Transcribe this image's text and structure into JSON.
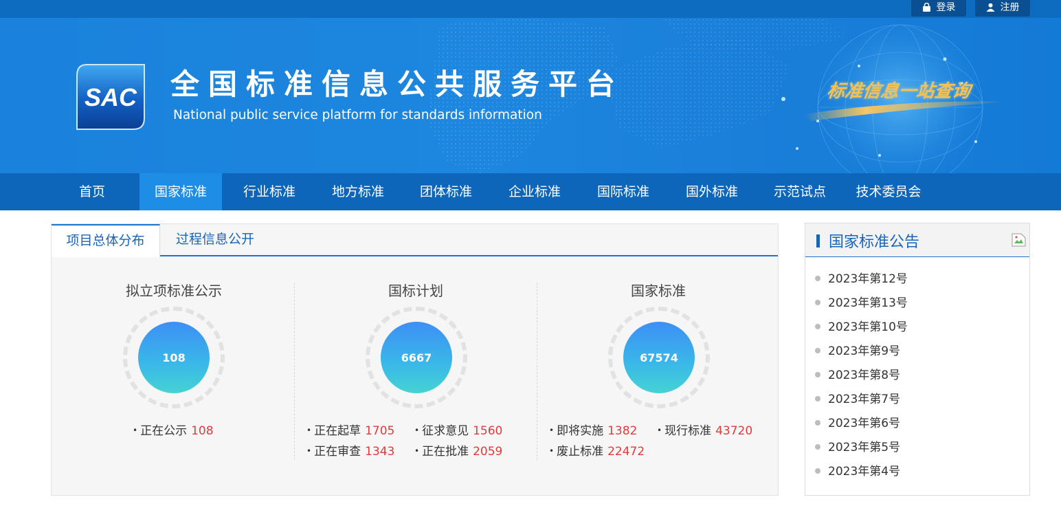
{
  "topbar": {
    "login_label": "登录",
    "register_label": "注册"
  },
  "banner": {
    "logo_text": "SAC",
    "title_cn": "全国标准信息公共服务平台",
    "title_en": "National public service platform  for standards information",
    "slogan": "标准信息一站查询"
  },
  "nav": {
    "items": [
      {
        "label": "首页"
      },
      {
        "label": "国家标准",
        "active": true
      },
      {
        "label": "行业标准"
      },
      {
        "label": "地方标准"
      },
      {
        "label": "团体标准"
      },
      {
        "label": "企业标准"
      },
      {
        "label": "国际标准"
      },
      {
        "label": "国外标准"
      },
      {
        "label": "示范试点"
      },
      {
        "label": "技术委员会"
      }
    ]
  },
  "main": {
    "tabs": [
      {
        "label": "项目总体分布",
        "active": true
      },
      {
        "label": "过程信息公开"
      }
    ],
    "columns": [
      {
        "title": "拟立项标准公示",
        "total": "108",
        "stats": [
          {
            "label": "正在公示",
            "value": "108"
          }
        ]
      },
      {
        "title": "国标计划",
        "total": "6667",
        "stats": [
          {
            "label": "正在起草",
            "value": "1705"
          },
          {
            "label": "征求意见",
            "value": "1560"
          },
          {
            "label": "正在审查",
            "value": "1343"
          },
          {
            "label": "正在批准",
            "value": "2059"
          }
        ]
      },
      {
        "title": "国家标准",
        "total": "67574",
        "stats": [
          {
            "label": "即将实施",
            "value": "1382"
          },
          {
            "label": "现行标准",
            "value": "43720"
          },
          {
            "label": "废止标准",
            "value": "22472"
          }
        ]
      }
    ]
  },
  "sidebar": {
    "title": "国家标准公告",
    "notices": [
      {
        "label": "2023年第12号"
      },
      {
        "label": "2023年第13号"
      },
      {
        "label": "2023年第10号"
      },
      {
        "label": "2023年第9号"
      },
      {
        "label": "2023年第8号"
      },
      {
        "label": "2023年第7号"
      },
      {
        "label": "2023年第6号"
      },
      {
        "label": "2023年第5号"
      },
      {
        "label": "2023年第4号"
      }
    ]
  },
  "colors": {
    "brand_blue": "#0d66b9",
    "nav_active": "#1e8de6",
    "accent_red": "#e23a3a",
    "slogan_gold": "#f4c152"
  }
}
